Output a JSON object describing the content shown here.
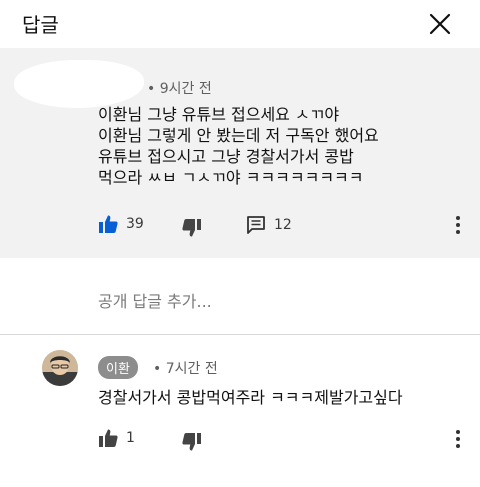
{
  "header": {
    "title": "답글"
  },
  "top_comment": {
    "time": "9시간 전",
    "lines": [
      "이환님 그냥 유튜브 접으세요 ㅅㄲ야",
      "이환님 그렇게 안 봤는데 저 구독안 했어요",
      "유튜브 접으시고 그냥 경찰서가서 콩밥",
      "먹으라 ㅆㅂ ㄱㅅㄲ야 ㅋㅋㅋㅋㅋㅋㅋㅋ"
    ],
    "likes": "39",
    "replies": "12"
  },
  "add_reply": {
    "placeholder": "공개 답글 추가..."
  },
  "reply": {
    "author": "이환",
    "time": "7시간 전",
    "text": "경찰서가서 콩밥먹여주라 ㅋㅋㅋ제발가고싶다",
    "likes": "1"
  },
  "colors": {
    "thumb_active": "#065fd4",
    "thread_bg": "#f2f2f2",
    "chip_bg": "#8d8d8d"
  }
}
